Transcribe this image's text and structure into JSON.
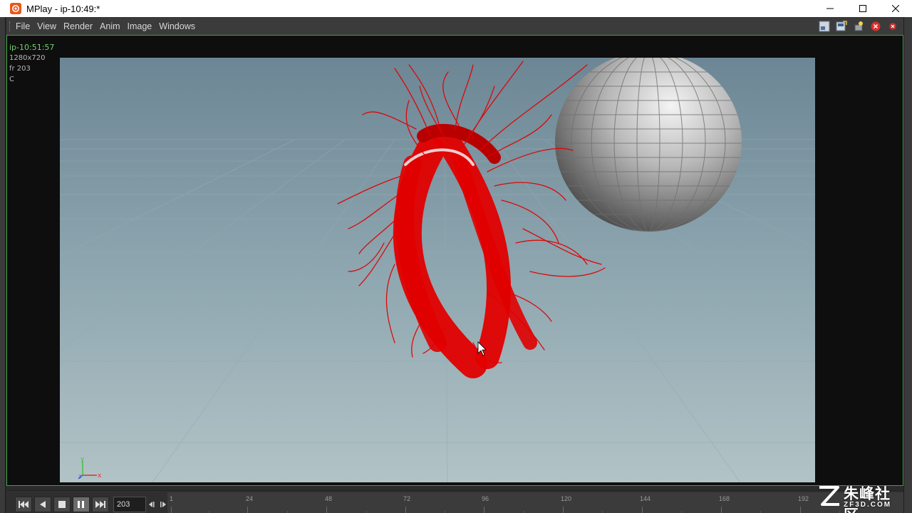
{
  "window": {
    "title": "MPlay - ip-10:49:*",
    "app_icon": "houdini-icon"
  },
  "menu": {
    "items": [
      "File",
      "View",
      "Render",
      "Anim",
      "Image",
      "Windows"
    ]
  },
  "toolbar": {
    "icons": [
      "viewport-layout-icon",
      "save-image-icon",
      "light-icon",
      "close-red-icon",
      "close-red-small-icon"
    ]
  },
  "image_info": {
    "name": "ip-10:51:57",
    "resolution": "1280x720",
    "frame": "fr 203",
    "channel": "C"
  },
  "viewport": {
    "axis_labels": {
      "y": "y",
      "x": "x",
      "z": "z"
    },
    "colors": {
      "hair": "#e10000",
      "sky_top": "#6d8796",
      "sky_bottom": "#a9bcc2",
      "sphere": "#a9a9a9"
    }
  },
  "playbar": {
    "current_frame": "203",
    "timeline_ticks": [
      "1",
      "24",
      "48",
      "72",
      "96",
      "120",
      "144",
      "168",
      "192"
    ]
  },
  "watermark": {
    "text_cn": "朱峰社区",
    "url": "ZF3D.COM"
  }
}
